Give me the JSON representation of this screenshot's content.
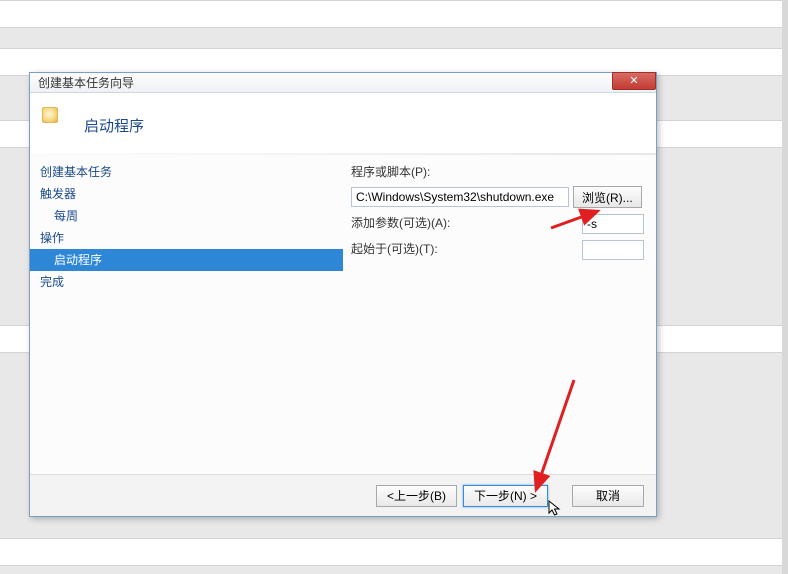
{
  "dialog": {
    "title": "创建基本任务向导",
    "close_glyph": "✕",
    "header_title": "启动程序"
  },
  "sidebar": {
    "items": [
      {
        "label": "创建基本任务",
        "indent": false,
        "selected": false
      },
      {
        "label": "触发器",
        "indent": false,
        "selected": false
      },
      {
        "label": "每周",
        "indent": true,
        "selected": false
      },
      {
        "label": "操作",
        "indent": false,
        "selected": false
      },
      {
        "label": "启动程序",
        "indent": true,
        "selected": true
      },
      {
        "label": "完成",
        "indent": false,
        "selected": false
      }
    ]
  },
  "form": {
    "program_label": "程序或脚本(P):",
    "program_value": "C:\\Windows\\System32\\shutdown.exe",
    "browse_label": "浏览(R)...",
    "args_label": "添加参数(可选)(A):",
    "args_value": "-s",
    "startin_label": "起始于(可选)(T):",
    "startin_value": ""
  },
  "footer": {
    "back_label": "<上一步(B)",
    "next_label": "下一步(N) >",
    "cancel_label": "取消"
  }
}
